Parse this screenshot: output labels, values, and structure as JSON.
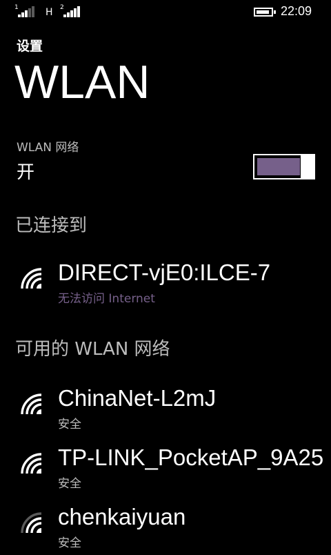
{
  "status_bar": {
    "sim1": "1",
    "sim2": "2",
    "network_type": "H",
    "time": "22:09",
    "battery_icon": "battery-icon"
  },
  "header": {
    "breadcrumb": "设置",
    "title": "WLAN"
  },
  "wlan_toggle": {
    "label": "WLAN 网络",
    "state": "开",
    "on": true,
    "accent_color": "#76608a"
  },
  "connected": {
    "section_title": "已连接到",
    "networks": [
      {
        "ssid": "DIRECT-vjE0:ILCE-7",
        "status": "无法访问 Internet",
        "signal": "full"
      }
    ]
  },
  "available": {
    "section_title": "可用的 WLAN 网络",
    "networks": [
      {
        "ssid": "ChinaNet-L2mJ",
        "status": "安全",
        "signal": "full"
      },
      {
        "ssid": "TP-LINK_PocketAP_9A25",
        "status": "安全",
        "signal": "full"
      },
      {
        "ssid": "chenkaiyuan",
        "status": "安全",
        "signal": "medium"
      }
    ]
  }
}
